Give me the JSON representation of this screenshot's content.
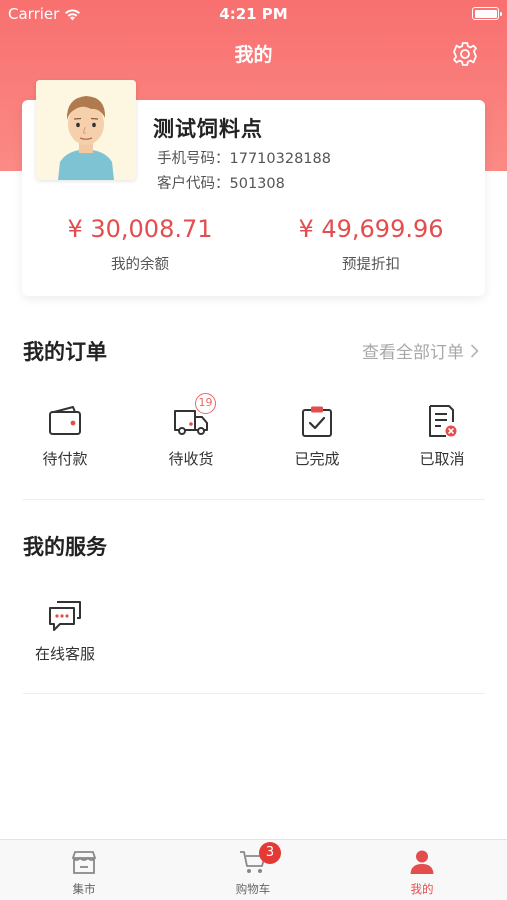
{
  "status_bar": {
    "carrier": "Carrier",
    "time": "4:21 PM"
  },
  "nav": {
    "title": "我的",
    "settings_icon": "gear-icon"
  },
  "profile": {
    "name": "测试饲料点",
    "phone_label": "手机号码：",
    "phone": "17710328188",
    "code_label": "客户代码：",
    "code": "501308",
    "balance_value": "¥ 30,008.71",
    "balance_label": "我的余额",
    "discount_value": "¥ 49,699.96",
    "discount_label": "预提折扣"
  },
  "orders": {
    "title": "我的订单",
    "view_all": "查看全部订单",
    "items": [
      {
        "label": "待付款",
        "icon": "wallet-icon"
      },
      {
        "label": "待收货",
        "icon": "truck-icon",
        "badge": "19"
      },
      {
        "label": "已完成",
        "icon": "check-clipboard-icon"
      },
      {
        "label": "已取消",
        "icon": "cancel-document-icon"
      }
    ]
  },
  "services": {
    "title": "我的服务",
    "items": [
      {
        "label": "在线客服",
        "icon": "chat-icon"
      }
    ]
  },
  "tabbar": {
    "items": [
      {
        "label": "集市",
        "icon": "market-icon"
      },
      {
        "label": "购物车",
        "icon": "cart-icon",
        "badge": "3"
      },
      {
        "label": "我的",
        "icon": "profile-icon",
        "active": true
      }
    ]
  },
  "colors": {
    "header": "#f87070",
    "accent": "#e34d4d",
    "badge": "#e53935"
  }
}
